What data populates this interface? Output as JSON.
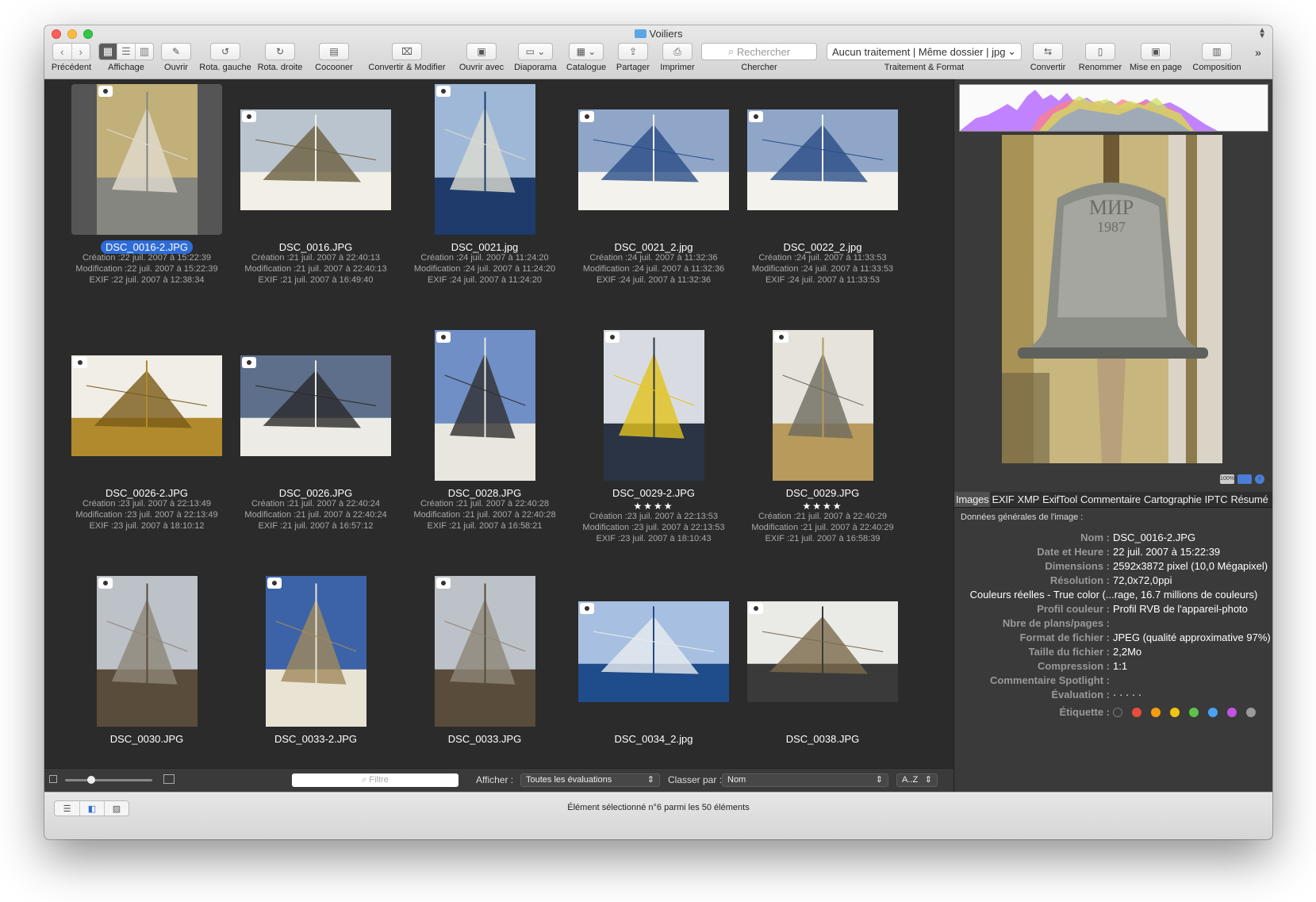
{
  "window": {
    "title": "Voiliers"
  },
  "toolbar": {
    "previous": "Précédent",
    "display": "Affichage",
    "open": "Ouvrir",
    "rotate_left": "Rota. gauche",
    "rotate_right": "Rota. droite",
    "tag": "Cocooner",
    "convert_modify": "Convertir & Modifier",
    "open_with": "Ouvrir avec",
    "slideshow": "Diaporama",
    "catalog": "Catalogue",
    "share": "Partager",
    "print": "Imprimer",
    "search_placeholder": "Rechercher",
    "search_label": "Chercher",
    "processing_value": "Aucun traitement | Même dossier | jpg",
    "processing_label": "Traitement & Format",
    "convert": "Convertir",
    "rename": "Renommer",
    "layout": "Mise en page",
    "composition": "Composition",
    "more": "»"
  },
  "thumbnails": [
    {
      "name": "DSC_0016-2.JPG",
      "orient": "port",
      "selected": true,
      "palette": "bell",
      "stars": "",
      "creation": "Création :22 juil. 2007 à 15:22:39",
      "modification": "Modification :22 juil. 2007 à 15:22:39",
      "exif": "EXIF :22 juil. 2007 à 12:38:34"
    },
    {
      "name": "DSC_0016.JPG",
      "orient": "land",
      "selected": false,
      "palette": "deck",
      "stars": "",
      "creation": "Création :21 juil. 2007 à 22:40:13",
      "modification": "Modification :21 juil. 2007 à 22:40:13",
      "exif": "EXIF :21 juil. 2007 à 16:49:40"
    },
    {
      "name": "DSC_0021.jpg",
      "orient": "port",
      "selected": false,
      "palette": "sea-sail",
      "stars": "",
      "creation": "Création :24 juil. 2007 à 11:24:20",
      "modification": "Modification :24 juil. 2007 à 11:24:20",
      "exif": "EXIF :24 juil. 2007 à 11:24:20"
    },
    {
      "name": "DSC_0021_2.jpg",
      "orient": "land",
      "selected": false,
      "palette": "ship",
      "stars": "",
      "creation": "Création :24 juil. 2007 à 11:32:36",
      "modification": "Modification :24 juil. 2007 à 11:32:36",
      "exif": "EXIF :24 juil. 2007 à 11:32:36"
    },
    {
      "name": "DSC_0022_2.jpg",
      "orient": "land",
      "selected": false,
      "palette": "ship",
      "stars": "",
      "creation": "Création :24 juil. 2007 à 11:33:53",
      "modification": "Modification :24 juil. 2007 à 11:33:53",
      "exif": "EXIF :24 juil. 2007 à 11:33:53"
    },
    {
      "name": "DSC_0026-2.JPG",
      "orient": "land",
      "selected": false,
      "palette": "gold",
      "stars": "",
      "creation": "Création :23 juil. 2007 à 22:13:49",
      "modification": "Modification :23 juil. 2007 à 22:13:49",
      "exif": "EXIF :23 juil. 2007 à 18:10:12"
    },
    {
      "name": "DSC_0026.JPG",
      "orient": "land",
      "selected": false,
      "palette": "hull-white",
      "stars": "",
      "creation": "Création :21 juil. 2007 à 22:40:24",
      "modification": "Modification :21 juil. 2007 à 22:40:24",
      "exif": "EXIF :21 juil. 2007 à 16:57:12"
    },
    {
      "name": "DSC_0028.JPG",
      "orient": "port",
      "selected": false,
      "palette": "sailor",
      "stars": "",
      "creation": "Création :21 juil. 2007 à 22:40:28",
      "modification": "Modification :21 juil. 2007 à 22:40:28",
      "exif": "EXIF :21 juil. 2007 à 16:58:21"
    },
    {
      "name": "DSC_0029-2.JPG",
      "orient": "port",
      "selected": false,
      "palette": "flag",
      "stars": "★★★★",
      "creation": "Création :23 juil. 2007 à 22:13:53",
      "modification": "Modification :23 juil. 2007 à 22:13:53",
      "exif": "EXIF :23 juil. 2007 à 18:10:43"
    },
    {
      "name": "DSC_0029.JPG",
      "orient": "port",
      "selected": false,
      "palette": "bridge",
      "stars": "★★★★",
      "creation": "Création :21 juil. 2007 à 22:40:29",
      "modification": "Modification :21 juil. 2007 à 22:40:29",
      "exif": "EXIF :21 juil. 2007 à 16:58:39"
    },
    {
      "name": "DSC_0030.JPG",
      "orient": "port",
      "selected": false,
      "palette": "rigging",
      "stars": "",
      "creation": "",
      "modification": "",
      "exif": ""
    },
    {
      "name": "DSC_0033-2.JPG",
      "orient": "port",
      "selected": false,
      "palette": "masts",
      "stars": "",
      "creation": "",
      "modification": "",
      "exif": ""
    },
    {
      "name": "DSC_0033.JPG",
      "orient": "port",
      "selected": false,
      "palette": "rigging",
      "stars": "",
      "creation": "",
      "modification": "",
      "exif": ""
    },
    {
      "name": "DSC_0034_2.jpg",
      "orient": "land",
      "selected": false,
      "palette": "sea-far",
      "stars": "",
      "creation": "",
      "modification": "",
      "exif": ""
    },
    {
      "name": "DSC_0038.JPG",
      "orient": "land",
      "selected": false,
      "palette": "pulleys",
      "stars": "",
      "creation": "",
      "modification": "",
      "exif": ""
    }
  ],
  "browser_bar": {
    "filter_placeholder": "Filtre",
    "show_label": "Afficher :",
    "show_value": "Toutes les évaluations",
    "sort_label": "Classer par :",
    "sort_value": "Nom",
    "order_value": "A..Z"
  },
  "inspector": {
    "zoom_badge": "100%",
    "tabs": [
      "Images",
      "EXIF",
      "XMP",
      "ExifTool",
      "Commentaire",
      "Cartographie",
      "IPTC",
      "Résumé"
    ],
    "active_tab": "Images",
    "section_title": "Données générales de l'image :",
    "rows": [
      {
        "k": "Nom :",
        "v": "DSC_0016-2.JPG"
      },
      {
        "k": "Date et Heure :",
        "v": "22 juil. 2007 à 15:22:39"
      },
      {
        "k": "Dimensions :",
        "v": "2592x3872 pixel (10,0 Mégapixel)"
      },
      {
        "k": "Résolution :",
        "v": "72,0x72,0ppi"
      },
      {
        "k": "",
        "v": "Couleurs réelles - True color (...rage, 16.7 millions de couleurs)"
      },
      {
        "k": "Profil couleur :",
        "v": "Profil RVB de l'appareil-photo"
      },
      {
        "k": "Nbre de plans/pages :",
        "v": ""
      },
      {
        "k": "Format de fichier :",
        "v": "JPEG (qualité approximative 97%)"
      },
      {
        "k": "Taille du fichier :",
        "v": "2,2Mo"
      },
      {
        "k": "Compression :",
        "v": "1:1"
      },
      {
        "k": "Commentaire Spotlight :",
        "v": ""
      },
      {
        "k": "Évaluation :",
        "v": "·  ·  ·  ·  ·"
      },
      {
        "k": "Étiquette :",
        "v": ""
      }
    ],
    "label_colors": [
      "#e74c3c",
      "#f39c12",
      "#f1c40f",
      "#5cc44a",
      "#4aa3f0",
      "#c154e0",
      "#9a9a9a"
    ]
  },
  "status": {
    "text": "Élément sélectionné n°6 parmi les 50 éléments"
  }
}
